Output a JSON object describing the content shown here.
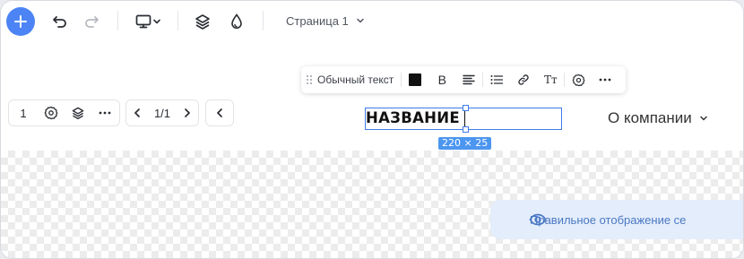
{
  "toolbar": {
    "add_icon": "plus-icon",
    "undo_icon": "undo-icon",
    "redo_icon": "redo-icon",
    "device_icon": "monitor-icon",
    "layers_icon": "layers-icon",
    "style_icon": "drop-icon",
    "page_label": "Страница 1",
    "accent": "#4c84f5"
  },
  "block_controls": {
    "number": "1",
    "pagination": "1/1"
  },
  "text_toolbar": {
    "style_label": "Обычный текст",
    "text_color": "#111111",
    "bold_label": "B",
    "size_label": "Tт"
  },
  "header": {
    "title": "НАЗВАНИЕ",
    "size_badge": "220 × 25",
    "menu_item": "О компании"
  },
  "notice": {
    "text": "Правильное отображение се"
  }
}
